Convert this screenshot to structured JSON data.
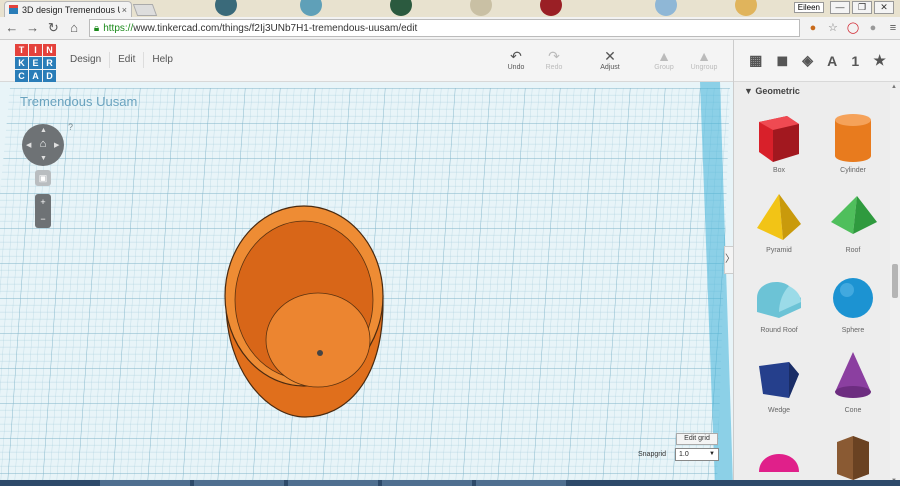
{
  "browser": {
    "tab_title": "3D design Tremendous U",
    "tab_close": "×",
    "user_badge": "Eileen",
    "window_controls": [
      "—",
      "❐",
      "✕"
    ],
    "url_secure": "https://",
    "url_rest": "www.tinkercad.com/things/f2Ij3UNb7H1-tremendous-uusam/edit",
    "nav_icons": [
      "back-icon",
      "forward-icon",
      "reload-icon",
      "home-icon"
    ]
  },
  "app": {
    "logo_letters": [
      "T",
      "I",
      "N",
      "K",
      "E",
      "R",
      "C",
      "A",
      "D"
    ],
    "logo_colors": [
      "#e4423c",
      "#e4423c",
      "#e4423c",
      "#2a7db8",
      "#2a7db8",
      "#2a7db8",
      "#2a7db8",
      "#2a7db8",
      "#2a7db8"
    ],
    "menu": [
      "Design",
      "Edit",
      "Help"
    ],
    "toolbar": {
      "undo": "Undo",
      "redo": "Redo",
      "adjust": "Adjust",
      "group": "Group",
      "ungroup": "Ungroup"
    }
  },
  "viewport": {
    "design_name": "Tremendous Uusam",
    "help": "?",
    "edit_grid": "Edit grid",
    "snap_grid_label": "Snapgrid",
    "snap_grid_value": "1.0",
    "collapse": "〉",
    "model_color": "#f0832a"
  },
  "panel": {
    "tabs": [
      "grid-view-icon",
      "cube-icon",
      "cubes-icon",
      "A",
      "1",
      "★"
    ],
    "section": "Geometric",
    "shapes": [
      {
        "label": "Box",
        "icon": "box-icon",
        "color": "#d8202a"
      },
      {
        "label": "Cylinder",
        "icon": "cylinder-icon",
        "color": "#e87b1e"
      },
      {
        "label": "Pyramid",
        "icon": "pyramid-icon",
        "color": "#f2c416"
      },
      {
        "label": "Roof",
        "icon": "roof-icon",
        "color": "#2f9a3e"
      },
      {
        "label": "Round Roof",
        "icon": "round-roof-icon",
        "color": "#6cc3d6"
      },
      {
        "label": "Sphere",
        "icon": "sphere-icon",
        "color": "#1c93d2"
      },
      {
        "label": "Wedge",
        "icon": "wedge-icon",
        "color": "#253f8c"
      },
      {
        "label": "Cone",
        "icon": "cone-icon",
        "color": "#8b3fa0"
      },
      {
        "label": "",
        "icon": "half-sphere-icon",
        "color": "#e0208a"
      },
      {
        "label": "",
        "icon": "polygon-icon",
        "color": "#8a5a33"
      }
    ]
  }
}
